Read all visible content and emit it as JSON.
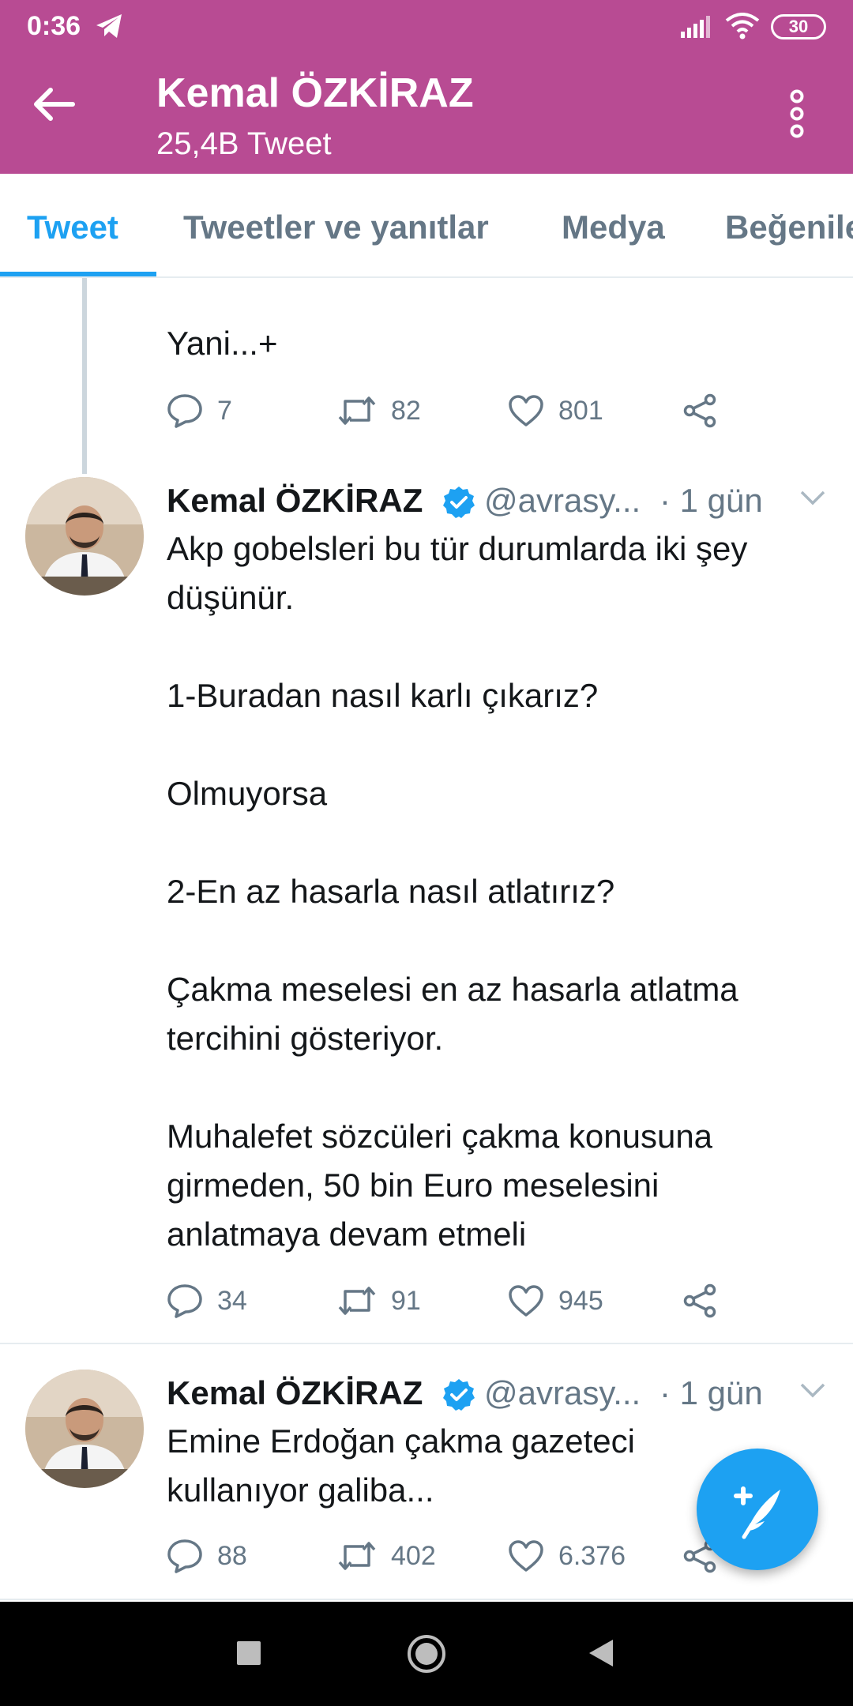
{
  "status_bar": {
    "time": "0:36",
    "battery": "30"
  },
  "header": {
    "title": "Kemal ÖZKİRAZ",
    "subtitle": "25,4B Tweet"
  },
  "tabs": [
    {
      "label": "Tweet",
      "active": true
    },
    {
      "label": "Tweetler ve yanıtlar",
      "active": false
    },
    {
      "label": "Medya",
      "active": false
    },
    {
      "label": "Beğenile",
      "active": false
    }
  ],
  "tweets": [
    {
      "text": "Yani...+",
      "replies": "7",
      "retweets": "82",
      "likes": "801"
    },
    {
      "name": "Kemal ÖZKİRAZ",
      "handle": "@avrasy...",
      "time": "· 1 gün",
      "text": "Akp gobelsleri bu tür durumlarda iki şey\ndüşünür.\n\n1-Buradan nasıl karlı çıkarız?\n\nOlmuyorsa\n\n2-En az hasarla nasıl atlatırız?\n\nÇakma meselesi en az hasarla atlatma\ntercihini gösteriyor.\n\nMuhalefet sözcüleri çakma konusuna\ngirmeden, 50 bin Euro meselesini\nanlatmaya devam etmeli",
      "replies": "34",
      "retweets": "91",
      "likes": "945"
    },
    {
      "name": "Kemal ÖZKİRAZ",
      "handle": "@avrasy...",
      "time": "· 1 gün",
      "text": "Emine Erdoğan çakma gazeteci\nkullanıyor galiba...",
      "replies": "88",
      "retweets": "402",
      "likes": "6.376"
    }
  ],
  "colors": {
    "header": "#b84b93",
    "accent": "#1da1f2",
    "muted": "#657786"
  },
  "icons": [
    "back-arrow-icon",
    "more-vertical-icon",
    "reply-icon",
    "retweet-icon",
    "like-icon",
    "share-icon",
    "verified-icon",
    "chevron-down-icon",
    "compose-tweet-icon"
  ]
}
